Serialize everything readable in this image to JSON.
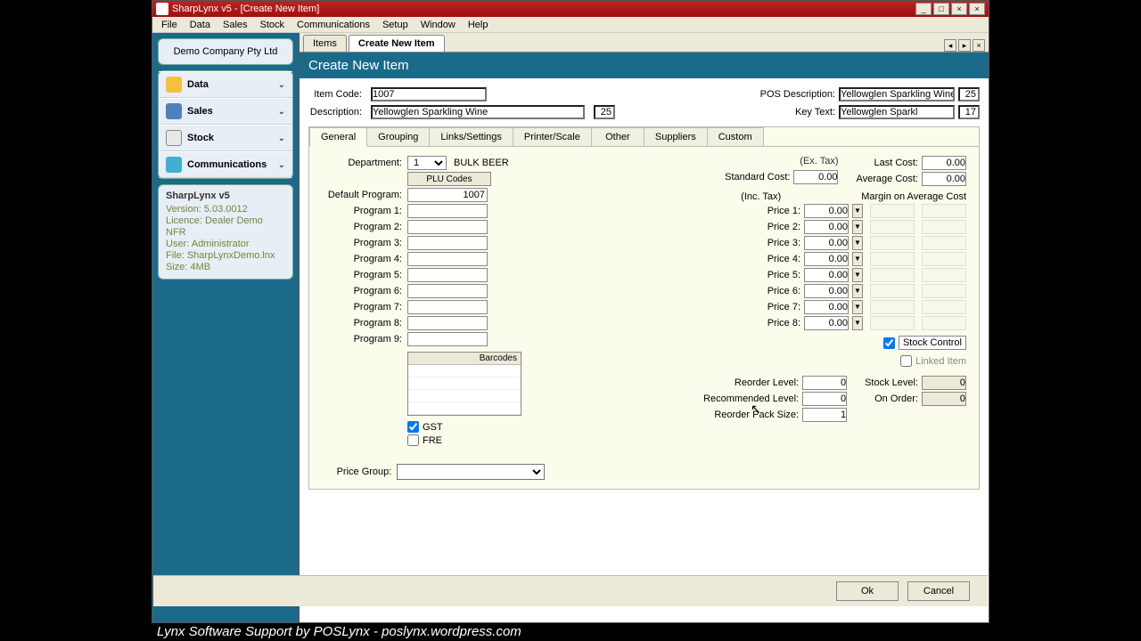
{
  "window": {
    "title": "SharpLynx v5 - [Create New Item]"
  },
  "menu": [
    "File",
    "Data",
    "Sales",
    "Stock",
    "Communications",
    "Setup",
    "Window",
    "Help"
  ],
  "company": "Demo Company Pty Ltd",
  "sidebar": [
    "Data",
    "Sales",
    "Stock",
    "Communications"
  ],
  "info": {
    "product": "SharpLynx v5",
    "version": "Version: 5.03.0012",
    "licence": "Licence: Dealer Demo NFR",
    "user": "User: Administrator",
    "file": "File: SharpLynxDemo.lnx",
    "size": "Size: 4MB"
  },
  "tabs": {
    "items": "Items",
    "create": "Create New Item"
  },
  "page_title": "Create New Item",
  "labels": {
    "item_code": "Item Code:",
    "description": "Description:",
    "pos_desc": "POS Description:",
    "key_text": "Key Text:",
    "department": "Department:",
    "default_program": "Default Program:",
    "p1": "Program 1:",
    "p2": "Program 2:",
    "p3": "Program 3:",
    "p4": "Program 4:",
    "p5": "Program 5:",
    "p6": "Program 6:",
    "p7": "Program 7:",
    "p8": "Program 8:",
    "p9": "Program 9:",
    "plu": "PLU Codes",
    "barcodes": "Barcodes",
    "gst": "GST",
    "fre": "FRE",
    "price_group": "Price Group:",
    "ex_tax": "(Ex. Tax)",
    "inc_tax": "(Inc. Tax)",
    "std_cost": "Standard Cost:",
    "last_cost": "Last Cost:",
    "avg_cost": "Average Cost:",
    "margin": "Margin on Average Cost",
    "price1": "Price 1:",
    "price2": "Price 2:",
    "price3": "Price 3:",
    "price4": "Price 4:",
    "price5": "Price 5:",
    "price6": "Price 6:",
    "price7": "Price 7:",
    "price8": "Price 8:",
    "stock_control": "Stock Control",
    "linked_item": "Linked Item",
    "reorder_level": "Reorder Level:",
    "recommended": "Recommended Level:",
    "reorder_pack": "Reorder Pack Size:",
    "stock_level": "Stock Level:",
    "on_order": "On Order:",
    "ok": "Ok",
    "cancel": "Cancel",
    "dept_name": "BULK BEER"
  },
  "values": {
    "item_code": "1007",
    "description": "Yellowglen Sparkling Wine",
    "desc_cnt": "25",
    "pos_desc": "Yellowglen Sparkling Wine",
    "pos_cnt": "25",
    "key_text": "Yellowglen Sparkl",
    "key_cnt": "17",
    "department": "1",
    "default_program": "1007",
    "std_cost": "0.00",
    "last_cost": "0.00",
    "avg_cost": "0.00",
    "price": "0.00",
    "reorder_level": "0",
    "recommended": "0",
    "reorder_pack": "1",
    "stock_level": "0",
    "on_order": "0"
  },
  "inner_tabs": [
    "General",
    "Grouping",
    "Links/Settings",
    "Printer/Scale",
    "Other",
    "Suppliers",
    "Custom"
  ],
  "caption": "Lynx Software Support by POSLynx - poslynx.wordpress.com"
}
